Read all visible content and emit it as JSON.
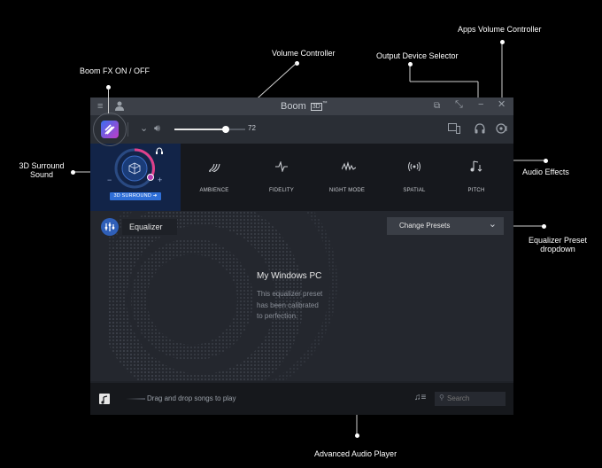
{
  "callouts": {
    "boom_fx": "Boom FX ON / OFF",
    "volume_controller": "Volume Controller",
    "output_device": "Output Device Selector",
    "apps_volume": "Apps Volume Controller",
    "surround_line1": "3D Surround",
    "surround_line2": "Sound",
    "audio_effects": "Audio Effects",
    "eq_preset_line1": "Equalizer Preset",
    "eq_preset_line2": "dropdown",
    "audio_player": "Advanced Audio Player"
  },
  "titlebar": {
    "title": "Boom",
    "badge": "3D",
    "tm": "™"
  },
  "toolbar": {
    "volume_value": "72",
    "volume_level": 0.72
  },
  "surround": {
    "button_label": "3D SURROUND ➜",
    "minus": "−",
    "plus": "+"
  },
  "effects": [
    {
      "label": "AMBIENCE",
      "icon": "ambience-icon"
    },
    {
      "label": "FIDELITY",
      "icon": "fidelity-icon"
    },
    {
      "label": "NIGHT MODE",
      "icon": "night-mode-icon"
    },
    {
      "label": "SPATIAL",
      "icon": "spatial-icon"
    },
    {
      "label": "PITCH",
      "icon": "pitch-icon"
    }
  ],
  "equalizer": {
    "label": "Equalizer",
    "preset_button": "Change Presets",
    "preset_title": "My Windows PC",
    "preset_desc_line1": "This equalizer preset",
    "preset_desc_line2": "has been calibrated",
    "preset_desc_line3": "to perfection."
  },
  "player": {
    "drop_text": "Drag and drop songs to play",
    "search_placeholder": "Search"
  },
  "colors": {
    "accent": "#e0408a",
    "brand_blue": "#2f6fd8"
  }
}
